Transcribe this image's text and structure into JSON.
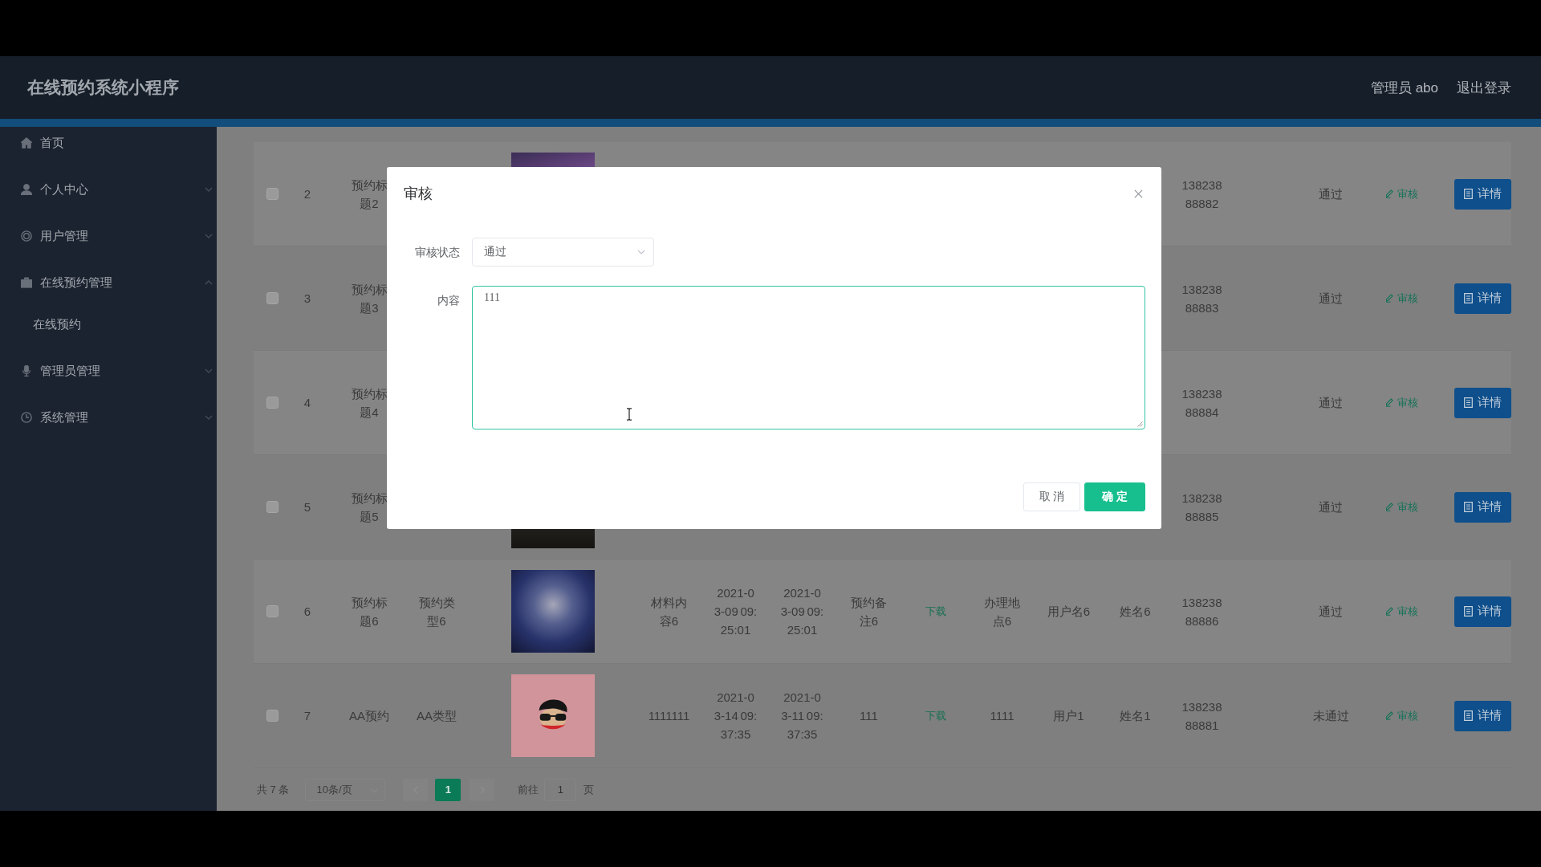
{
  "header": {
    "title": "在线预约系统小程序",
    "user": "管理员 abo",
    "logout": "退出登录"
  },
  "sidebar": {
    "items": [
      {
        "label": "首页",
        "kind": "link"
      },
      {
        "label": "个人中心",
        "kind": "group",
        "expanded": false
      },
      {
        "label": "用户管理",
        "kind": "group",
        "expanded": false
      },
      {
        "label": "在线预约管理",
        "kind": "group",
        "expanded": true,
        "children": [
          {
            "label": "在线预约"
          }
        ]
      },
      {
        "label": "管理员管理",
        "kind": "group",
        "expanded": false
      },
      {
        "label": "系统管理",
        "kind": "group",
        "expanded": false
      }
    ]
  },
  "table": {
    "rows": [
      {
        "checked": false,
        "index": "2",
        "title": "预约标题2",
        "image": {
          "kind": "photo"
        },
        "phone": "13823888882",
        "status": "通过",
        "review": "审核",
        "detail": "详情"
      },
      {
        "checked": false,
        "index": "3",
        "title": "预约标题3",
        "phone": "13823888883",
        "status": "通过",
        "review": "审核",
        "detail": "详情"
      },
      {
        "checked": false,
        "index": "4",
        "title": "预约标题4",
        "phone": "13823888884",
        "status": "通过",
        "review": "审核",
        "detail": "详情"
      },
      {
        "checked": false,
        "index": "5",
        "title": "预约标题5",
        "image": {
          "kind": "photo"
        },
        "phone": "13823888885",
        "status": "通过",
        "review": "审核",
        "detail": "详情"
      },
      {
        "checked": false,
        "index": "6",
        "title": "预约标题6",
        "type": "预约类型6",
        "image": {
          "kind": "photo"
        },
        "materials": "材料内容6",
        "start": "2021-03-09 09:25:01",
        "end": "2021-03-09 09:25:01",
        "note": "预约备注6",
        "download": "下载",
        "location": "办理地点6",
        "username": "用户名6",
        "name": "姓名6",
        "phone": "13823888886",
        "status": "通过",
        "review": "审核",
        "detail": "详情"
      },
      {
        "checked": false,
        "index": "7",
        "title": "AA预约",
        "type": "AA类型",
        "image": {
          "kind": "cartoon"
        },
        "materials": "1111111",
        "start": "2021-03-14 09:37:35",
        "end": "2021-03-11 09:37:35",
        "note": "111",
        "download": "下载",
        "location": "1111",
        "username": "用户1",
        "name": "姓名1",
        "phone": "13823888881",
        "status": "未通过",
        "review": "审核",
        "detail": "详情"
      }
    ]
  },
  "pagination": {
    "total": "共 7 条",
    "page_size": "10条/页",
    "pages": [
      {
        "label": "1",
        "selected": true
      }
    ],
    "goto": {
      "label": "前往",
      "value": "1",
      "suffix": "页"
    }
  },
  "dialog": {
    "title": "审核",
    "fields": [
      {
        "label": "审核状态",
        "kind": "select",
        "value": "通过"
      },
      {
        "label": "内容",
        "kind": "textarea",
        "value": "111"
      }
    ],
    "buttons": [
      {
        "label": "取 消",
        "kind": "default"
      },
      {
        "label": "确 定",
        "kind": "primary"
      }
    ]
  }
}
